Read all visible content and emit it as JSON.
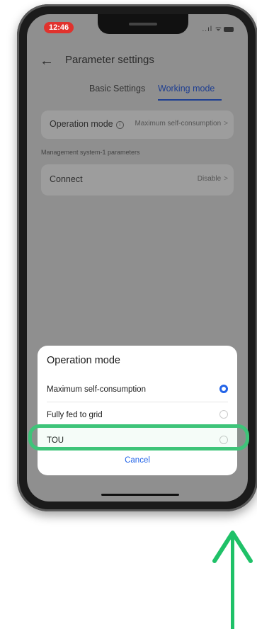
{
  "status_bar": {
    "time": "12:46",
    "icons": "..ıl ᯤ"
  },
  "header": {
    "back_icon": "←",
    "title": "Parameter settings"
  },
  "tabs": [
    {
      "label": "Basic Settings",
      "active": false
    },
    {
      "label": "Working mode",
      "active": true
    }
  ],
  "operation_row": {
    "label": "Operation mode",
    "value": "Maximum self-consumption",
    "chevron": ">"
  },
  "section_note": "Management system-1 parameters",
  "connect_row": {
    "label": "Connect",
    "value": "Disable",
    "chevron": ">"
  },
  "sheet": {
    "title": "Operation mode",
    "options": [
      {
        "label": "Maximum self-consumption",
        "selected": true
      },
      {
        "label": "Fully fed to grid",
        "selected": false
      },
      {
        "label": "TOU",
        "selected": false
      }
    ],
    "cancel_label": "Cancel"
  },
  "colors": {
    "accent": "#2364e8",
    "tab_active": "#1f3f91",
    "highlight": "#3ec479",
    "arrow": "#1fc168",
    "time_badge": "#e0322d"
  }
}
